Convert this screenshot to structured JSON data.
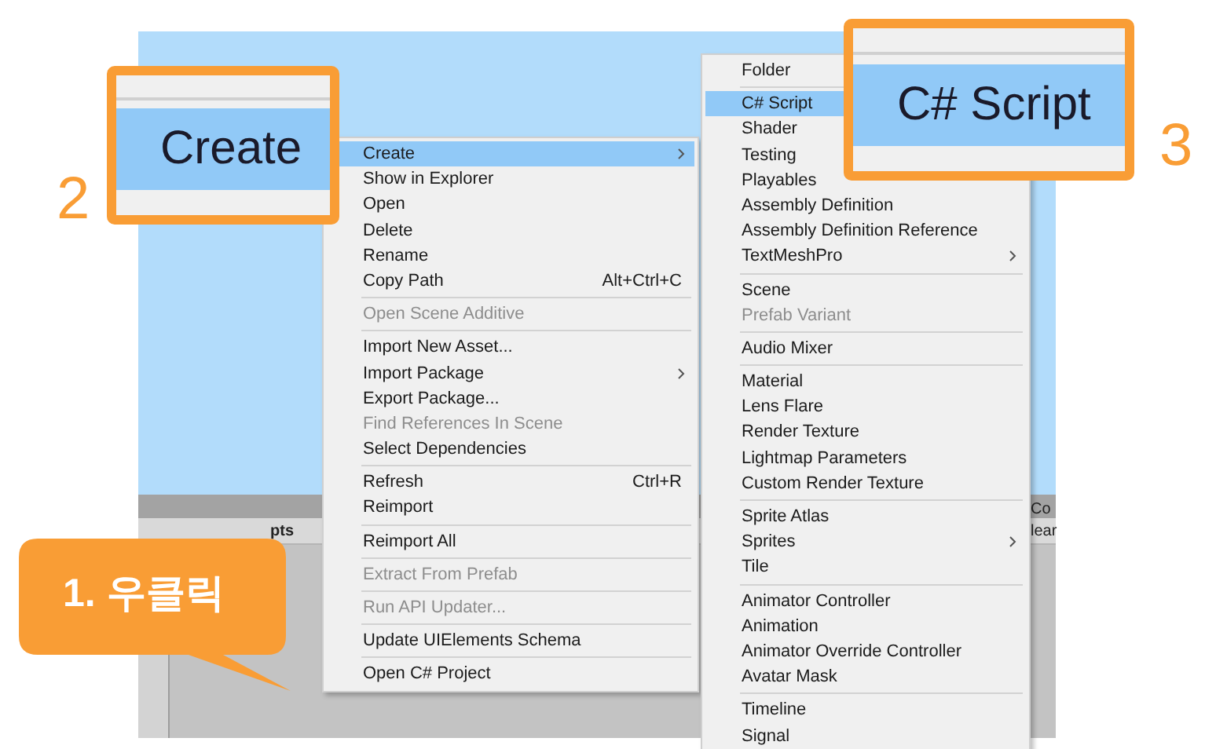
{
  "background_window": {
    "tab_fragment": "pts",
    "right_fragments": [
      "Co",
      "lear"
    ]
  },
  "context_menu": {
    "groups": [
      [
        {
          "label": "Create",
          "submenu": true,
          "disabled": false,
          "selected": true
        },
        {
          "label": "Show in Explorer",
          "submenu": false,
          "disabled": false,
          "selected": false
        },
        {
          "label": "Open",
          "submenu": false,
          "disabled": false,
          "selected": false
        },
        {
          "label": "Delete",
          "submenu": false,
          "disabled": false,
          "selected": false
        },
        {
          "label": "Rename",
          "submenu": false,
          "disabled": false,
          "selected": false
        },
        {
          "label": "Copy Path",
          "shortcut": "Alt+Ctrl+C",
          "submenu": false,
          "disabled": false,
          "selected": false
        }
      ],
      [
        {
          "label": "Open Scene Additive",
          "submenu": false,
          "disabled": true,
          "selected": false
        }
      ],
      [
        {
          "label": "Import New Asset...",
          "submenu": false,
          "disabled": false,
          "selected": false
        },
        {
          "label": "Import Package",
          "submenu": true,
          "disabled": false,
          "selected": false
        },
        {
          "label": "Export Package...",
          "submenu": false,
          "disabled": false,
          "selected": false
        },
        {
          "label": "Find References In Scene",
          "submenu": false,
          "disabled": true,
          "selected": false
        },
        {
          "label": "Select Dependencies",
          "submenu": false,
          "disabled": false,
          "selected": false
        }
      ],
      [
        {
          "label": "Refresh",
          "shortcut": "Ctrl+R",
          "submenu": false,
          "disabled": false,
          "selected": false
        },
        {
          "label": "Reimport",
          "submenu": false,
          "disabled": false,
          "selected": false
        }
      ],
      [
        {
          "label": "Reimport All",
          "submenu": false,
          "disabled": false,
          "selected": false
        }
      ],
      [
        {
          "label": "Extract From Prefab",
          "submenu": false,
          "disabled": true,
          "selected": false
        }
      ],
      [
        {
          "label": "Run API Updater...",
          "submenu": false,
          "disabled": true,
          "selected": false
        }
      ],
      [
        {
          "label": "Update UIElements Schema",
          "submenu": false,
          "disabled": false,
          "selected": false
        }
      ],
      [
        {
          "label": "Open C# Project",
          "submenu": false,
          "disabled": false,
          "selected": false
        }
      ]
    ]
  },
  "create_submenu": {
    "groups": [
      [
        {
          "label": "Folder",
          "submenu": false,
          "disabled": false,
          "selected": false
        }
      ],
      [
        {
          "label": "C# Script",
          "submenu": false,
          "disabled": false,
          "selected": true
        },
        {
          "label": "Shader",
          "submenu": false,
          "disabled": false,
          "selected": false
        },
        {
          "label": "Testing",
          "submenu": false,
          "disabled": false,
          "selected": false
        },
        {
          "label": "Playables",
          "submenu": false,
          "disabled": false,
          "selected": false
        },
        {
          "label": "Assembly Definition",
          "submenu": false,
          "disabled": false,
          "selected": false
        },
        {
          "label": "Assembly Definition Reference",
          "submenu": false,
          "disabled": false,
          "selected": false
        },
        {
          "label": "TextMeshPro",
          "submenu": true,
          "disabled": false,
          "selected": false
        }
      ],
      [
        {
          "label": "Scene",
          "submenu": false,
          "disabled": false,
          "selected": false
        },
        {
          "label": "Prefab Variant",
          "submenu": false,
          "disabled": true,
          "selected": false
        }
      ],
      [
        {
          "label": "Audio Mixer",
          "submenu": false,
          "disabled": false,
          "selected": false
        }
      ],
      [
        {
          "label": "Material",
          "submenu": false,
          "disabled": false,
          "selected": false
        },
        {
          "label": "Lens Flare",
          "submenu": false,
          "disabled": false,
          "selected": false
        },
        {
          "label": "Render Texture",
          "submenu": false,
          "disabled": false,
          "selected": false
        },
        {
          "label": "Lightmap Parameters",
          "submenu": false,
          "disabled": false,
          "selected": false
        },
        {
          "label": "Custom Render Texture",
          "submenu": false,
          "disabled": false,
          "selected": false
        }
      ],
      [
        {
          "label": "Sprite Atlas",
          "submenu": false,
          "disabled": false,
          "selected": false
        },
        {
          "label": "Sprites",
          "submenu": true,
          "disabled": false,
          "selected": false
        },
        {
          "label": "Tile",
          "submenu": false,
          "disabled": false,
          "selected": false
        }
      ],
      [
        {
          "label": "Animator Controller",
          "submenu": false,
          "disabled": false,
          "selected": false
        },
        {
          "label": "Animation",
          "submenu": false,
          "disabled": false,
          "selected": false
        },
        {
          "label": "Animator Override Controller",
          "submenu": false,
          "disabled": false,
          "selected": false
        },
        {
          "label": "Avatar Mask",
          "submenu": false,
          "disabled": false,
          "selected": false
        }
      ],
      [
        {
          "label": "Timeline",
          "submenu": false,
          "disabled": false,
          "selected": false
        },
        {
          "label": "Signal",
          "submenu": false,
          "disabled": false,
          "selected": false
        }
      ]
    ]
  },
  "annotations": [
    {
      "kind": "callout",
      "text": "1. 우클릭"
    },
    {
      "kind": "zoom",
      "number": "2",
      "text": "Create"
    },
    {
      "kind": "zoom",
      "number": "3",
      "text": "C# Script"
    }
  ]
}
